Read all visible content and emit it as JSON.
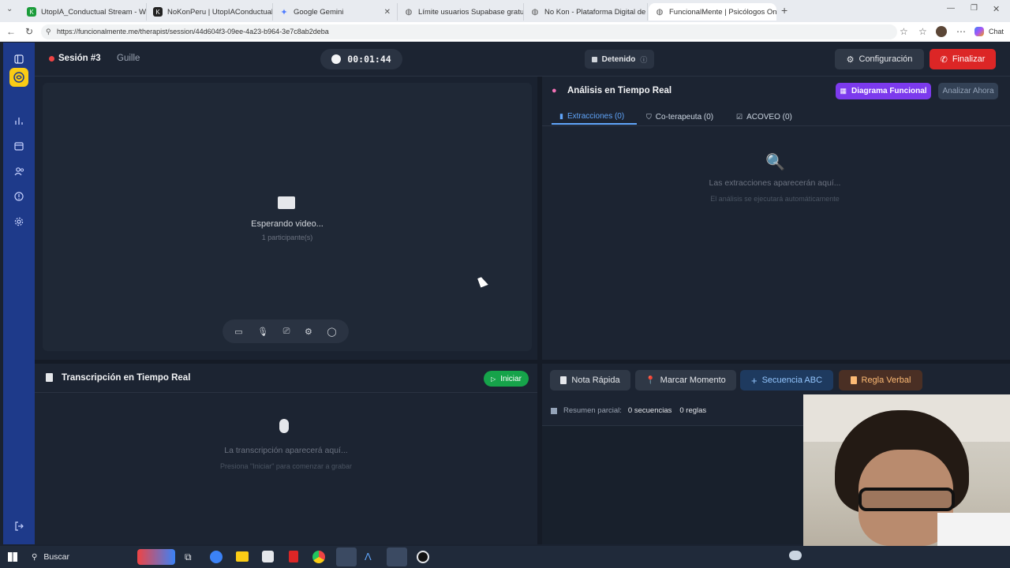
{
  "browser": {
    "tabs": [
      {
        "title": "UtopIA_Conductual Stream - Wat:",
        "color": "#1a9c3a"
      },
      {
        "title": "NoKonPeru | UtopIAConductual's",
        "color": "#222"
      },
      {
        "title": "Google Gemini",
        "color": "#4f7cff"
      },
      {
        "title": "Límite usuarios Supabase gratuito",
        "color": "#666"
      },
      {
        "title": "No Kon - Plataforma Digital de Ka",
        "color": "#666"
      },
      {
        "title": "FuncionalMente | Psicólogos Onli",
        "color": "#666"
      }
    ],
    "url": "https://funcionalmente.me/therapist/session/44d604f3-09ee-4a23-b964-3e7c8ab2deba",
    "chat_label": "Chat"
  },
  "header": {
    "session_title": "Sesión #3",
    "patient": "Guille",
    "timer": "00:01:44",
    "status": "Detenido",
    "config_label": "Configuración",
    "finish_label": "Finalizar"
  },
  "video": {
    "waiting": "Esperando video...",
    "participants": "1 participante(s)"
  },
  "analysis": {
    "title": "Análisis en Tiempo Real",
    "diagram_label": "Diagrama Funcional",
    "analyze_label": "Analizar Ahora",
    "tabs": [
      "Extracciones (0)",
      "Co-terapeuta (0)",
      "ACOVEO (0)"
    ],
    "empty_title": "Las extracciones aparecerán aquí...",
    "empty_sub": "El análisis se ejecutará automáticamente"
  },
  "transcript": {
    "title": "Transcripción en Tiempo Real",
    "start_label": "Iniciar",
    "empty_title": "La transcripción aparecerá aquí...",
    "empty_sub": "Presiona \"Iniciar\" para comenzar a grabar"
  },
  "tools": {
    "buttons": [
      "Nota Rápida",
      "Marcar Momento",
      "Secuencia ABC",
      "Regla Verbal"
    ],
    "summary_label": "Resumen parcial:",
    "sequences": "0 secuencias",
    "rules": "0 reglas"
  },
  "taskbar": {
    "search_placeholder": "Buscar"
  },
  "colors": {
    "sidebar": "#1e3a8a",
    "finish": "#dc2626",
    "start": "#16a34a",
    "diagram": "#7c3aed",
    "accent_tab": "#60a5fa"
  }
}
